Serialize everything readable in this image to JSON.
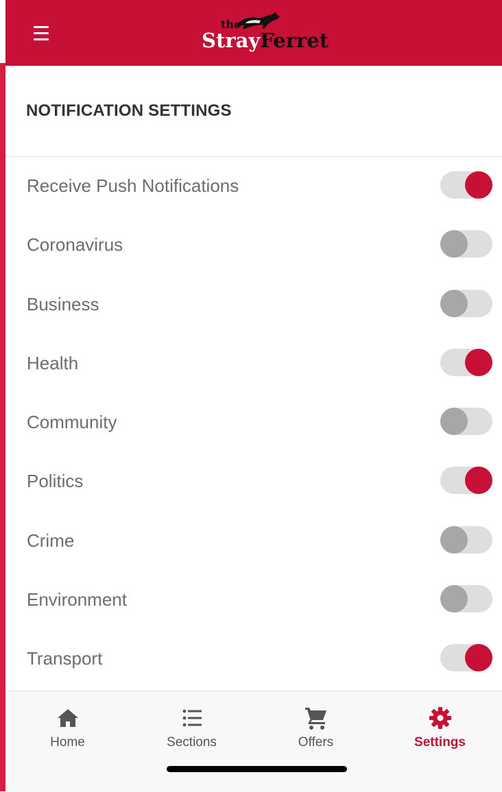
{
  "app": {
    "brand_prefix": "the",
    "brand_first": "Stray",
    "brand_second": "Ferret"
  },
  "header": {
    "menu_icon": "hamburger-icon"
  },
  "section": {
    "title": "NOTIFICATION SETTINGS"
  },
  "settings": [
    {
      "label": "Receive Push Notifications",
      "enabled": true
    },
    {
      "label": "Coronavirus",
      "enabled": false
    },
    {
      "label": "Business",
      "enabled": false
    },
    {
      "label": "Health",
      "enabled": true
    },
    {
      "label": "Community",
      "enabled": false
    },
    {
      "label": "Politics",
      "enabled": true
    },
    {
      "label": "Crime",
      "enabled": false
    },
    {
      "label": "Environment",
      "enabled": false
    },
    {
      "label": "Transport",
      "enabled": true
    }
  ],
  "tabs": [
    {
      "label": "Home",
      "icon": "home-icon",
      "active": false
    },
    {
      "label": "Sections",
      "icon": "list-icon",
      "active": false
    },
    {
      "label": "Offers",
      "icon": "cart-icon",
      "active": false
    },
    {
      "label": "Settings",
      "icon": "gear-icon",
      "active": true
    }
  ],
  "colors": {
    "brand_red": "#c80f35",
    "toggle_off_knob": "#a7a7a7",
    "toggle_track": "#dedede",
    "label_gray": "#6d6d6d"
  }
}
